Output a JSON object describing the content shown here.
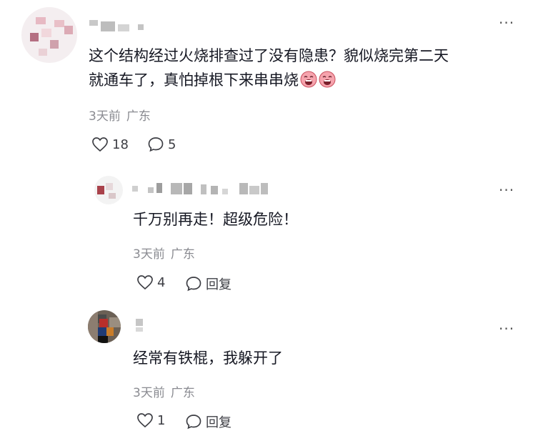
{
  "comments": [
    {
      "text": "这个结构经过火烧排查过了没有隐患？貌似烧完第二天",
      "text_line2": "就通车了，真怕掉根下来串串烧",
      "emojis": [
        "crying-face-emoji",
        "crying-face-emoji"
      ],
      "time": "3天前",
      "location": "广东",
      "likes": "18",
      "replies": "5",
      "more": "···"
    },
    {
      "text": "千万别再走！超级危险！",
      "time": "3天前",
      "location": "广东",
      "likes": "4",
      "reply_label": "回复",
      "more": "···"
    },
    {
      "text": "经常有铁棍，我躲开了",
      "time": "3天前",
      "location": "广东",
      "likes": "1",
      "reply_label": "回复",
      "more": "···"
    }
  ],
  "colors": {
    "text": "#161823",
    "meta": "#8a8b91",
    "icon": "#3d3e44"
  },
  "icons": {
    "like": "heart-outline-icon",
    "comment": "speech-bubble-icon",
    "more": "more-dots-icon"
  }
}
